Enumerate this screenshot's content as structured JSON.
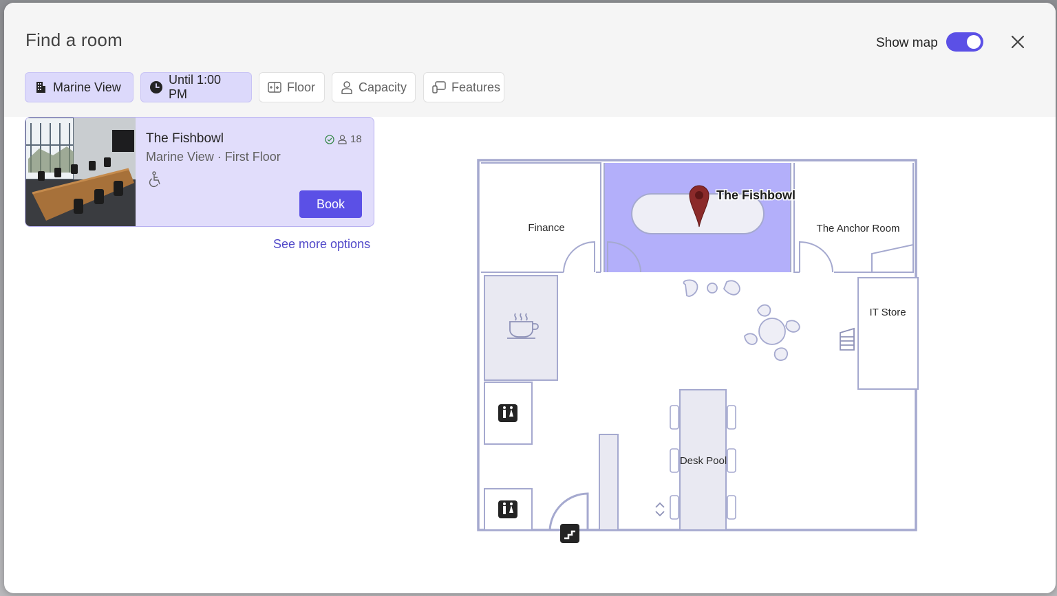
{
  "dialog": {
    "title": "Find a room",
    "show_map_label": "Show map",
    "show_map_on": true,
    "accent": "#5b50e6"
  },
  "filters": {
    "building": "Marine View",
    "time": "Until 1:00 PM",
    "floor": "Floor",
    "capacity": "Capacity",
    "features": "Features"
  },
  "room_card": {
    "name": "The Fishbowl",
    "location": "Marine View · First Floor",
    "capacity": "18",
    "book_label": "Book",
    "icons": [
      "check-circle-icon",
      "person-icon",
      "accessible-icon"
    ]
  },
  "see_more": "See more options",
  "map": {
    "pin_label": "The Fishbowl",
    "rooms": {
      "finance": "Finance",
      "anchor": "The Anchor Room",
      "it_store": "IT Store",
      "desk_pool": "Desk Pool"
    },
    "highlight_color": "#b3affa"
  }
}
